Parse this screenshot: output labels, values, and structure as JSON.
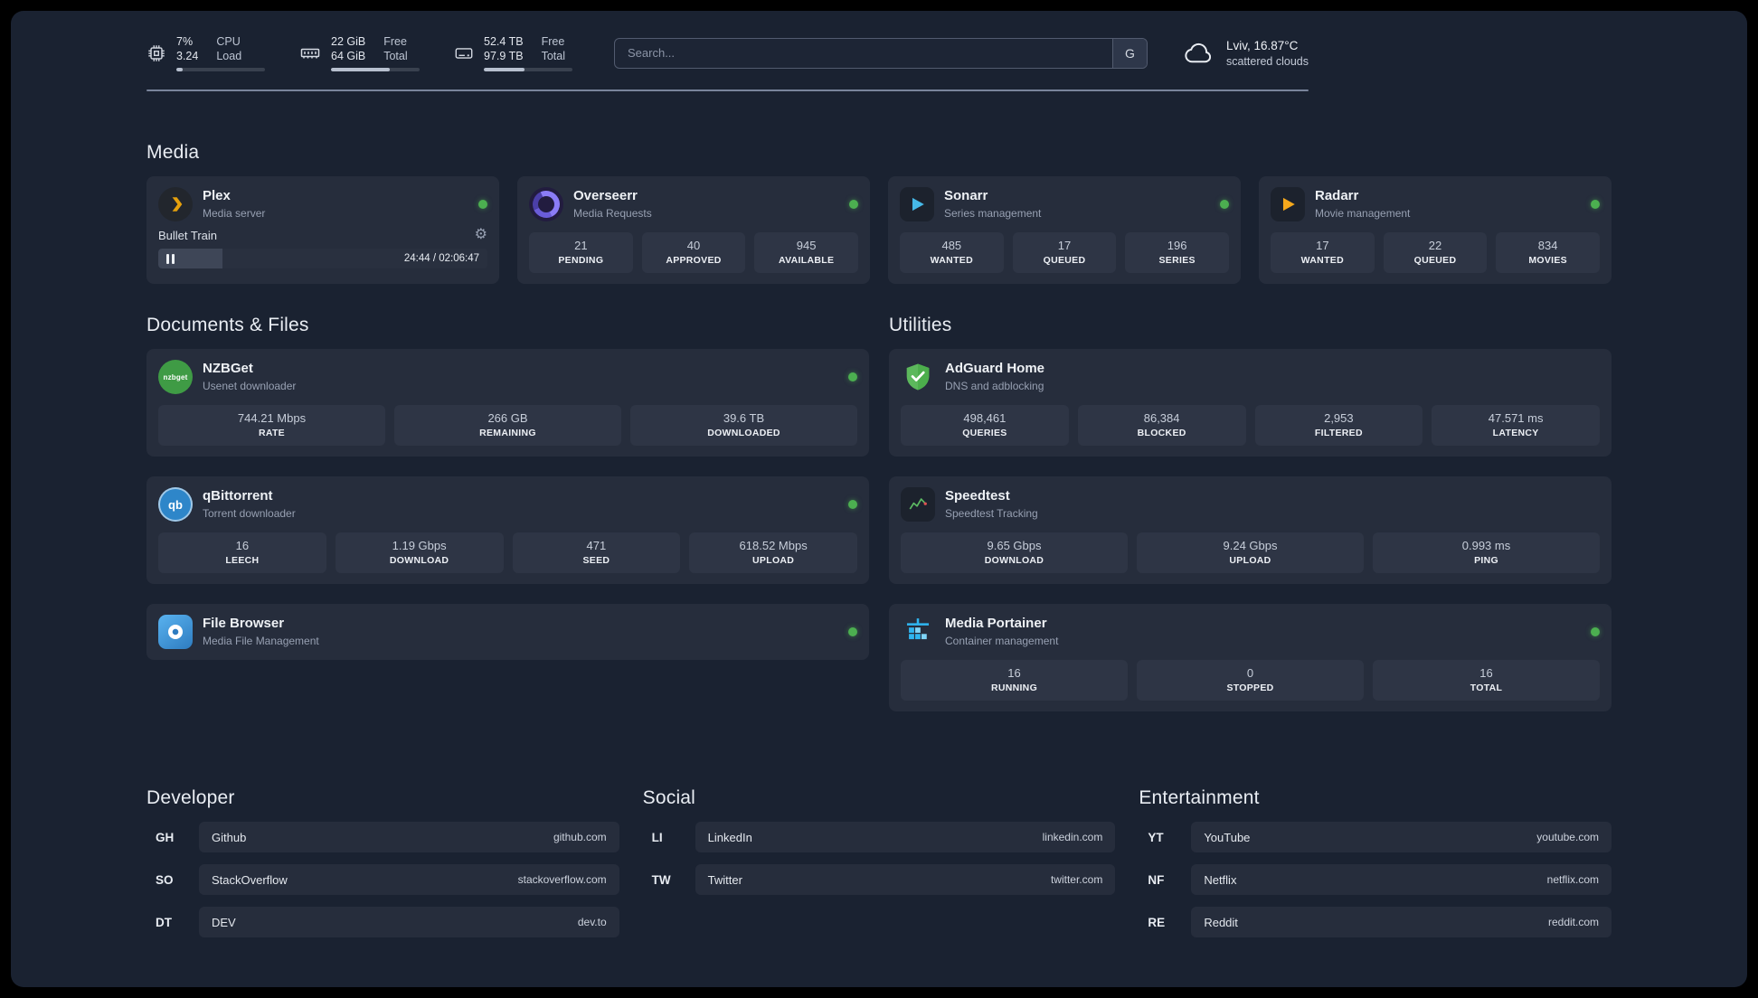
{
  "colors": {
    "status_online": "#4caf50",
    "plex": "#e5a00d",
    "overseerr": "#8b7cf7",
    "sonarr": "#46b9e8",
    "radarr": "#f5a81c",
    "nzbget": "#3f9b45",
    "qbittorrent": "#2e86c9",
    "filebrowser": "#3f94d6",
    "adguard": "#5cb85c",
    "speedtest_line": "#5dbb63",
    "portainer": "#2fb5f0"
  },
  "icons": {
    "gear": "⚙"
  },
  "system": {
    "cpu": {
      "value_top": "7%",
      "value_bottom": "3.24",
      "label_top": "CPU",
      "label_bottom": "Load",
      "bar_percent": 7
    },
    "ram": {
      "value_top": "22 GiB",
      "value_bottom": "64 GiB",
      "label_top": "Free",
      "label_bottom": "Total",
      "bar_percent": 66
    },
    "disk": {
      "value_top": "52.4 TB",
      "value_bottom": "97.9 TB",
      "label_top": "Free",
      "label_bottom": "Total",
      "bar_percent": 46
    }
  },
  "search": {
    "placeholder": "Search...",
    "engine_button": "G"
  },
  "weather": {
    "location": "Lviv, 16.87°C",
    "condition": "scattered clouds"
  },
  "sections": {
    "media": "Media",
    "documents": "Documents & Files",
    "utilities": "Utilities",
    "developer": "Developer",
    "social": "Social",
    "entertainment": "Entertainment"
  },
  "apps": {
    "plex": {
      "name": "Plex",
      "subtitle": "Media server",
      "player": {
        "title": "Bullet Train",
        "time": "24:44 / 02:06:47",
        "progress_percent": 19.5
      }
    },
    "overseerr": {
      "name": "Overseerr",
      "subtitle": "Media Requests",
      "stats": [
        {
          "value": "21",
          "label": "PENDING"
        },
        {
          "value": "40",
          "label": "APPROVED"
        },
        {
          "value": "945",
          "label": "AVAILABLE"
        }
      ]
    },
    "sonarr": {
      "name": "Sonarr",
      "subtitle": "Series management",
      "stats": [
        {
          "value": "485",
          "label": "WANTED"
        },
        {
          "value": "17",
          "label": "QUEUED"
        },
        {
          "value": "196",
          "label": "SERIES"
        }
      ]
    },
    "radarr": {
      "name": "Radarr",
      "subtitle": "Movie management",
      "stats": [
        {
          "value": "17",
          "label": "WANTED"
        },
        {
          "value": "22",
          "label": "QUEUED"
        },
        {
          "value": "834",
          "label": "MOVIES"
        }
      ]
    },
    "nzbget": {
      "name": "NZBGet",
      "subtitle": "Usenet downloader",
      "icon_text": "nzbget",
      "stats": [
        {
          "value": "744.21 Mbps",
          "label": "RATE"
        },
        {
          "value": "266 GB",
          "label": "REMAINING"
        },
        {
          "value": "39.6 TB",
          "label": "DOWNLOADED"
        }
      ]
    },
    "qbittorrent": {
      "name": "qBittorrent",
      "subtitle": "Torrent downloader",
      "icon_text": "qb",
      "stats": [
        {
          "value": "16",
          "label": "LEECH"
        },
        {
          "value": "1.19 Gbps",
          "label": "DOWNLOAD"
        },
        {
          "value": "471",
          "label": "SEED"
        },
        {
          "value": "618.52 Mbps",
          "label": "UPLOAD"
        }
      ]
    },
    "filebrowser": {
      "name": "File Browser",
      "subtitle": "Media File Management"
    },
    "adguard": {
      "name": "AdGuard Home",
      "subtitle": "DNS and adblocking",
      "stats": [
        {
          "value": "498,461",
          "label": "QUERIES"
        },
        {
          "value": "86,384",
          "label": "BLOCKED"
        },
        {
          "value": "2,953",
          "label": "FILTERED"
        },
        {
          "value": "47.571 ms",
          "label": "LATENCY"
        }
      ]
    },
    "speedtest": {
      "name": "Speedtest",
      "subtitle": "Speedtest Tracking",
      "stats": [
        {
          "value": "9.65 Gbps",
          "label": "DOWNLOAD"
        },
        {
          "value": "9.24 Gbps",
          "label": "UPLOAD"
        },
        {
          "value": "0.993 ms",
          "label": "PING"
        }
      ]
    },
    "portainer": {
      "name": "Media Portainer",
      "subtitle": "Container management",
      "stats": [
        {
          "value": "16",
          "label": "RUNNING"
        },
        {
          "value": "0",
          "label": "STOPPED"
        },
        {
          "value": "16",
          "label": "TOTAL"
        }
      ]
    }
  },
  "bookmarks": {
    "developer": [
      {
        "abbr": "GH",
        "name": "Github",
        "url": "github.com"
      },
      {
        "abbr": "SO",
        "name": "StackOverflow",
        "url": "stackoverflow.com"
      },
      {
        "abbr": "DT",
        "name": "DEV",
        "url": "dev.to"
      }
    ],
    "social": [
      {
        "abbr": "LI",
        "name": "LinkedIn",
        "url": "linkedin.com"
      },
      {
        "abbr": "TW",
        "name": "Twitter",
        "url": "twitter.com"
      }
    ],
    "entertainment": [
      {
        "abbr": "YT",
        "name": "YouTube",
        "url": "youtube.com"
      },
      {
        "abbr": "NF",
        "name": "Netflix",
        "url": "netflix.com"
      },
      {
        "abbr": "RE",
        "name": "Reddit",
        "url": "reddit.com"
      }
    ]
  }
}
